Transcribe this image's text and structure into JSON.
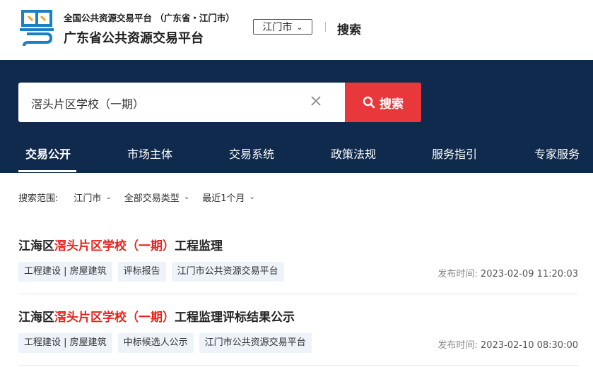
{
  "header": {
    "site_subtitle": "全国公共资源交易平台 （广东省・江门市）",
    "site_title": "广东省公共资源交易平台",
    "city_select": "江门市",
    "search_link": "搜索"
  },
  "search": {
    "value": "滘头片区学校（一期）",
    "button_label": "搜索"
  },
  "nav": {
    "items": [
      "交易公开",
      "市场主体",
      "交易系统",
      "政策法规",
      "服务指引",
      "专家服务"
    ],
    "active": "交易公开"
  },
  "filters": {
    "label": "搜索范围:",
    "city": "江门市",
    "type": "全部交易类型",
    "period": "最近1个月"
  },
  "results": [
    {
      "title_prefix": "江海区",
      "title_highlight": "滘头片区学校（一期）",
      "title_suffix": "工程监理",
      "tags": [
        "工程建设 | 房屋建筑",
        "评标报告",
        "江门市公共资源交易平台"
      ],
      "time_label": "发布时间:",
      "time_value": "2023-02-09 11:20:03"
    },
    {
      "title_prefix": "江海区",
      "title_highlight": "滘头片区学校（一期）",
      "title_suffix": "工程监理评标结果公示",
      "tags": [
        "工程建设 | 房屋建筑",
        "中标候选人公示",
        "江门市公共资源交易平台"
      ],
      "time_label": "发布时间:",
      "time_value": "2023-02-10 08:30:00"
    }
  ],
  "colors": {
    "hero_bg": "#0f2a4d",
    "accent_red": "#e8383c",
    "highlight": "#e8231c",
    "logo_blue": "#1b7fc4",
    "logo_orange": "#f4a11d",
    "tag_bg": "#eef3f9"
  }
}
